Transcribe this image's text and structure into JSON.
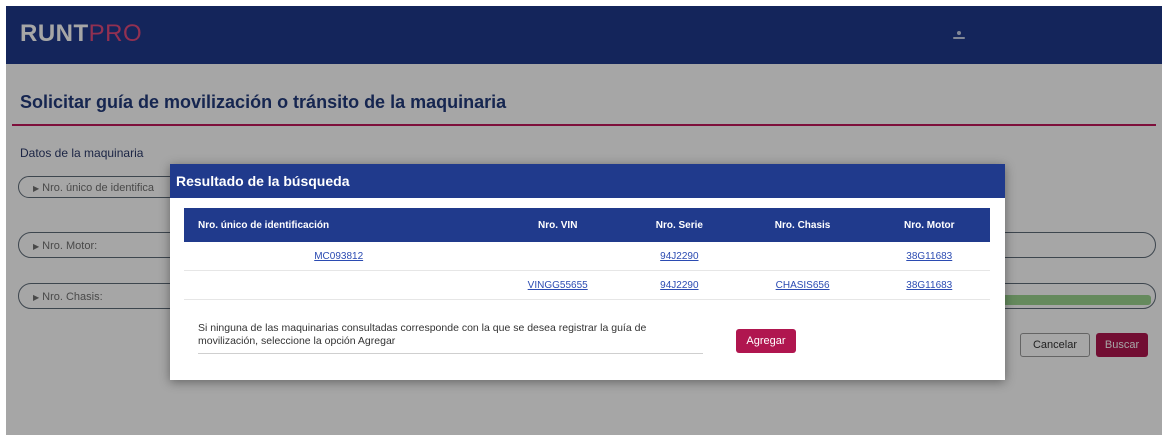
{
  "brand": {
    "name": "RUNT",
    "suffix": "PRO"
  },
  "page": {
    "title": "Solicitar guía de movilización o tránsito de la maquinaria",
    "section_label": "Datos de la maquinaria"
  },
  "fields": [
    {
      "placeholder": "Nro. único de identifica"
    },
    {
      "placeholder": "Nro. Motor:"
    },
    {
      "placeholder": "Nro. Chasis:"
    }
  ],
  "buttons": {
    "cancel": "Cancelar",
    "search": "Buscar"
  },
  "modal": {
    "title": "Resultado de la búsqueda",
    "columns": [
      "Nro. único de identificación",
      "Nro. VIN",
      "Nro. Serie",
      "Nro. Chasis",
      "Nro. Motor"
    ],
    "rows": [
      [
        "MC093812",
        "",
        "94J2290",
        "",
        "38G11683"
      ],
      [
        "",
        "VINGG55655",
        "94J2290",
        "CHASIS656",
        "38G11683"
      ]
    ],
    "note": "Si ninguna de las maquinarias consultadas corresponde con la que se desea registrar la guía de movilización, seleccione la opción Agregar",
    "add_label": "Agregar"
  },
  "colors": {
    "header": "#203a8c",
    "accent": "#c2185b",
    "button": "#b0164f",
    "success": "#9cd58f"
  },
  "icons": {
    "user": "user-icon",
    "caret": "caret-right-icon"
  }
}
